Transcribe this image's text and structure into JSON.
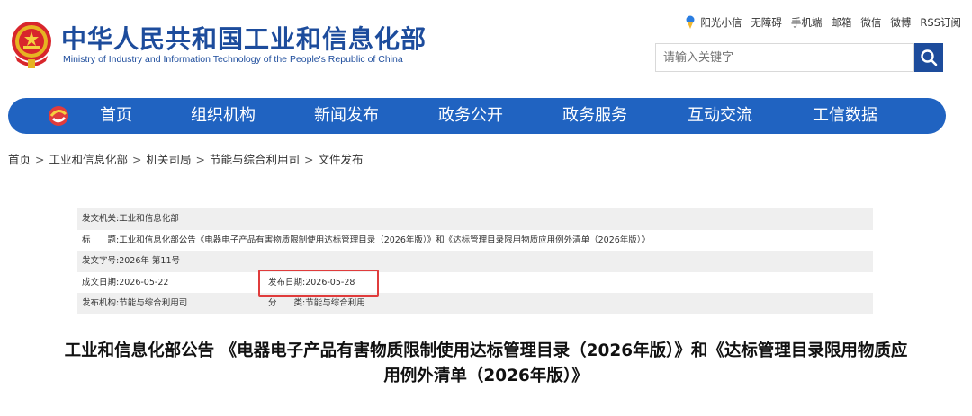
{
  "header": {
    "title_cn": "中华人民共和国工业和信息化部",
    "title_en": "Ministry of Industry and Information Technology of the People's Republic of China",
    "links": [
      "阳光小信",
      "无障碍",
      "手机端",
      "邮箱",
      "微信",
      "微博",
      "RSS订阅"
    ],
    "search_placeholder": "请输入关键字"
  },
  "nav": {
    "items": [
      "首页",
      "组织机构",
      "新闻发布",
      "政务公开",
      "政务服务",
      "互动交流",
      "工信数据"
    ]
  },
  "breadcrumb": [
    "首页",
    "工业和信息化部",
    "机关司局",
    "节能与综合利用司",
    "文件发布"
  ],
  "breadcrumb_sep": ">",
  "meta": {
    "issuer_label": "发文机关:",
    "issuer": "工业和信息化部",
    "title_label": "标　　题:",
    "title": "工业和信息化部公告《电器电子产品有害物质限制使用达标管理目录（2026年版）》和《达标管理目录限用物质应用例外清单（2026年版）》",
    "doc_number_label": "发文字号:",
    "doc_number": "2026年 第11号",
    "created_label": "成文日期:",
    "created": "2026-05-22",
    "published_label": "发布日期:",
    "published": "2026-05-28",
    "org_label": "发布机构:",
    "org": "节能与综合利用司",
    "category_label": "分　　类:",
    "category": "节能与综合利用"
  },
  "article": {
    "title": "工业和信息化部公告 《电器电子产品有害物质限制使用达标管理目录（2026年版）》和《达标管理目录限用物质应用例外清单（2026年版）》"
  },
  "colors": {
    "brand_blue": "#1d4c9c",
    "nav_blue": "#2063c1",
    "highlight_red": "#e03c3c",
    "row_shade": "#efefef"
  },
  "icons": [
    "national-emblem-icon",
    "sunshine-pin-icon",
    "search-icon",
    "nav-logo-icon"
  ]
}
